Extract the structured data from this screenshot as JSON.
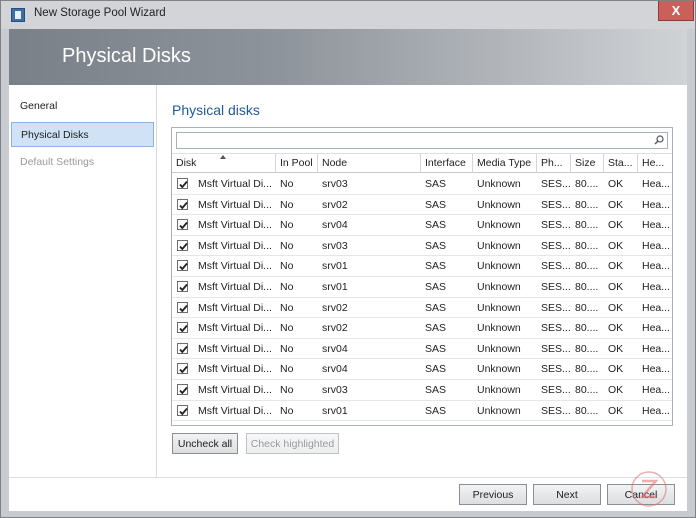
{
  "window": {
    "title": "New Storage Pool Wizard",
    "close_label": "X"
  },
  "header": {
    "title": "Physical Disks"
  },
  "sidebar": {
    "items": [
      {
        "label": "General",
        "state": "normal"
      },
      {
        "label": "Physical Disks",
        "state": "selected"
      },
      {
        "label": "Default Settings",
        "state": "disabled"
      }
    ]
  },
  "main": {
    "section_title": "Physical disks",
    "search": {
      "value": "",
      "placeholder": ""
    },
    "columns": [
      "Disk",
      "In Pool",
      "Node",
      "Interface",
      "Media Type",
      "Ph...",
      "Size",
      "Sta...",
      "He..."
    ],
    "sorted_column": "Disk",
    "rows": [
      {
        "checked": true,
        "disk": "Msft Virtual Di...",
        "in_pool": "No",
        "node": "srv03",
        "interface": "SAS",
        "media": "Unknown",
        "ph": "SES...",
        "size": "80....",
        "status": "OK",
        "health": "Hea..."
      },
      {
        "checked": true,
        "disk": "Msft Virtual Di...",
        "in_pool": "No",
        "node": "srv02",
        "interface": "SAS",
        "media": "Unknown",
        "ph": "SES...",
        "size": "80....",
        "status": "OK",
        "health": "Hea..."
      },
      {
        "checked": true,
        "disk": "Msft Virtual Di...",
        "in_pool": "No",
        "node": "srv04",
        "interface": "SAS",
        "media": "Unknown",
        "ph": "SES...",
        "size": "80....",
        "status": "OK",
        "health": "Hea..."
      },
      {
        "checked": true,
        "disk": "Msft Virtual Di...",
        "in_pool": "No",
        "node": "srv03",
        "interface": "SAS",
        "media": "Unknown",
        "ph": "SES...",
        "size": "80....",
        "status": "OK",
        "health": "Hea..."
      },
      {
        "checked": true,
        "disk": "Msft Virtual Di...",
        "in_pool": "No",
        "node": "srv01",
        "interface": "SAS",
        "media": "Unknown",
        "ph": "SES...",
        "size": "80....",
        "status": "OK",
        "health": "Hea..."
      },
      {
        "checked": true,
        "disk": "Msft Virtual Di...",
        "in_pool": "No",
        "node": "srv01",
        "interface": "SAS",
        "media": "Unknown",
        "ph": "SES...",
        "size": "80....",
        "status": "OK",
        "health": "Hea..."
      },
      {
        "checked": true,
        "disk": "Msft Virtual Di...",
        "in_pool": "No",
        "node": "srv02",
        "interface": "SAS",
        "media": "Unknown",
        "ph": "SES...",
        "size": "80....",
        "status": "OK",
        "health": "Hea..."
      },
      {
        "checked": true,
        "disk": "Msft Virtual Di...",
        "in_pool": "No",
        "node": "srv02",
        "interface": "SAS",
        "media": "Unknown",
        "ph": "SES...",
        "size": "80....",
        "status": "OK",
        "health": "Hea..."
      },
      {
        "checked": true,
        "disk": "Msft Virtual Di...",
        "in_pool": "No",
        "node": "srv04",
        "interface": "SAS",
        "media": "Unknown",
        "ph": "SES...",
        "size": "80....",
        "status": "OK",
        "health": "Hea..."
      },
      {
        "checked": true,
        "disk": "Msft Virtual Di...",
        "in_pool": "No",
        "node": "srv04",
        "interface": "SAS",
        "media": "Unknown",
        "ph": "SES...",
        "size": "80....",
        "status": "OK",
        "health": "Hea..."
      },
      {
        "checked": true,
        "disk": "Msft Virtual Di...",
        "in_pool": "No",
        "node": "srv03",
        "interface": "SAS",
        "media": "Unknown",
        "ph": "SES...",
        "size": "80....",
        "status": "OK",
        "health": "Hea..."
      },
      {
        "checked": true,
        "disk": "Msft Virtual Di...",
        "in_pool": "No",
        "node": "srv01",
        "interface": "SAS",
        "media": "Unknown",
        "ph": "SES...",
        "size": "80....",
        "status": "OK",
        "health": "Hea..."
      }
    ],
    "uncheck_all_label": "Uncheck all",
    "check_highlighted_label": "Check highlighted"
  },
  "footer": {
    "previous_label": "Previous",
    "next_label": "Next",
    "cancel_label": "Cancel"
  },
  "colors": {
    "accent": "#1f5a96",
    "selected_bg": "#cfe2f6",
    "close_button": "#c9605a"
  }
}
